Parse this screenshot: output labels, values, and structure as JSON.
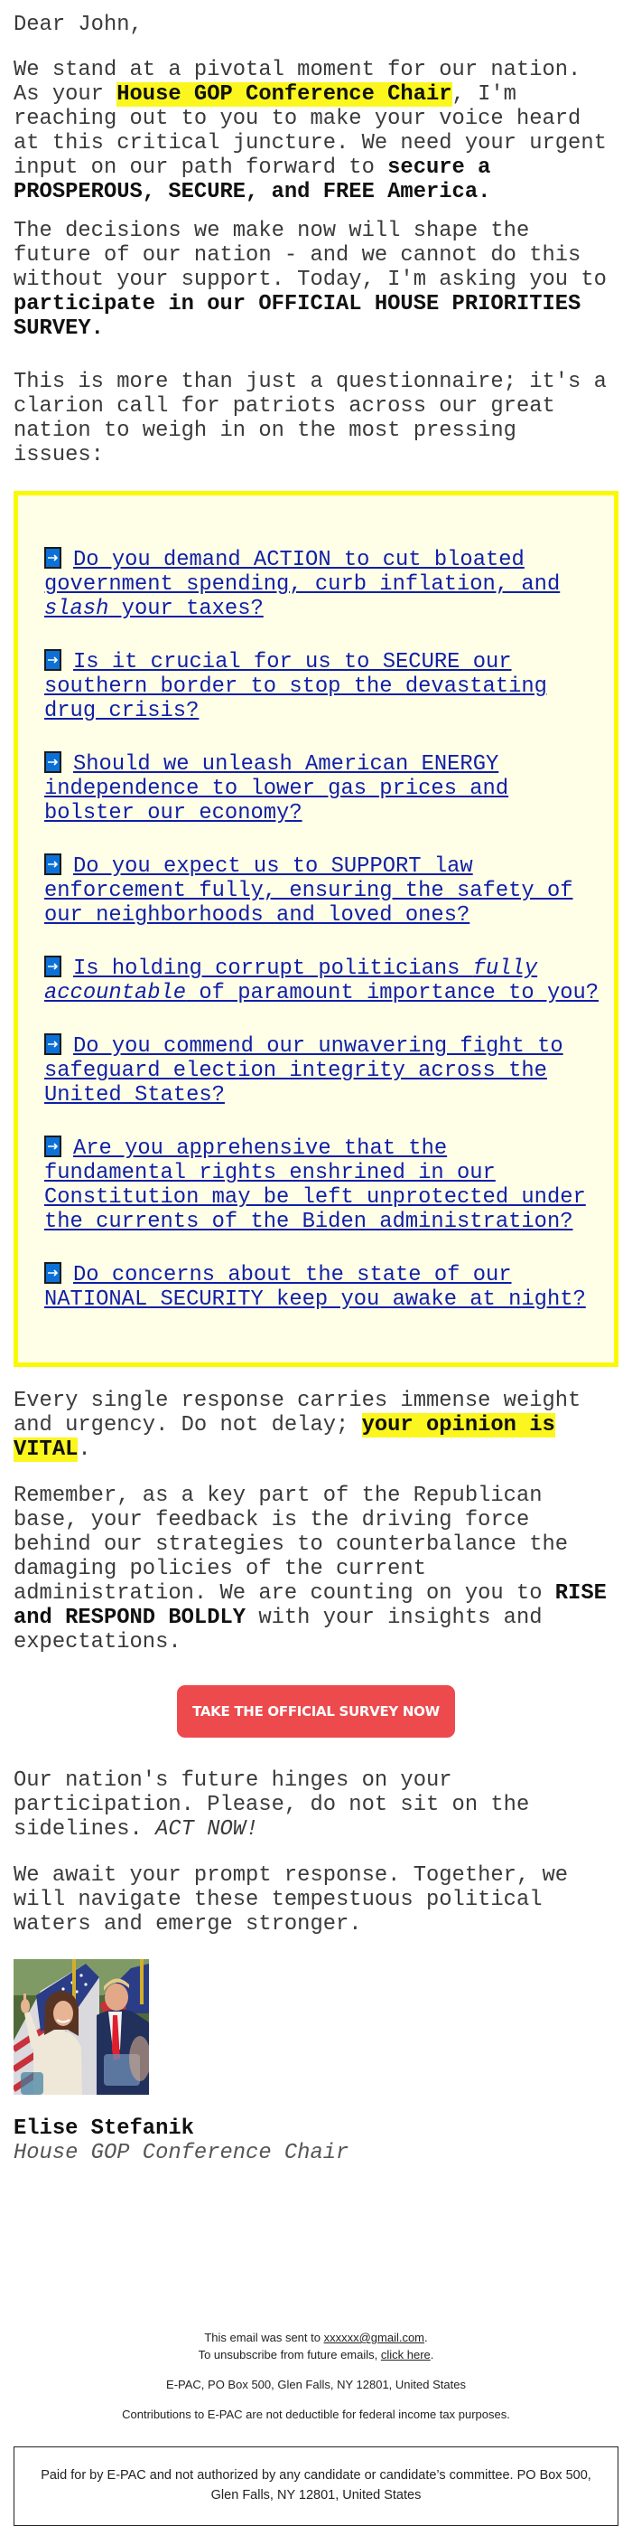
{
  "email": {
    "greeting": "Dear John,",
    "para1": {
      "t1": "We stand at a pivotal moment for our nation. As your ",
      "highlight": "House GOP Conference Chair",
      "t2": ", I'm reaching out to you to make your voice heard at this critical juncture. We need your urgent input on our path forward to ",
      "bold": "secure a PROSPEROUS, SECURE, and FREE America."
    },
    "para2": {
      "t1": "The decisions we make now will shape the future of our nation - and we cannot do this without your support. Today, I'm asking you to ",
      "bold": "participate in our OFFICIAL HOUSE PRIORITIES SURVEY."
    },
    "para3": "This is more than just a questionnaire; it's a clarion call for patriots across our great nation to weigh in on the most pressing issues:",
    "survey": {
      "icon": "right-arrow-button-icon",
      "items": [
        {
          "pre": "Do you demand ACTION to cut bloated government spending, curb inflation, and ",
          "em": "slash",
          "post": " your taxes?"
        },
        {
          "pre": "Is it crucial for us to SECURE our southern border to stop the devastating drug crisis?",
          "em": "",
          "post": ""
        },
        {
          "pre": "Should we unleash American ENERGY independence to lower gas prices and bolster our economy?",
          "em": "",
          "post": ""
        },
        {
          "pre": "Do you expect us to SUPPORT law enforcement fully, ensuring the safety of our neighborhoods and loved ones?",
          "em": "",
          "post": ""
        },
        {
          "pre": "Is holding corrupt politicians ",
          "em": "fully accountable",
          "post": " of paramount importance to you?"
        },
        {
          "pre": "Do you commend our unwavering fight to safeguard election integrity across the United States?",
          "em": "",
          "post": ""
        },
        {
          "pre": "Are you apprehensive that the fundamental rights enshrined in our Constitution may be left unprotected under the currents of the Biden administration?",
          "em": "",
          "post": ""
        },
        {
          "pre": "Do concerns about the state of our NATIONAL SECURITY keep you awake at night?",
          "em": "",
          "post": ""
        }
      ]
    },
    "para4": {
      "t1": "Every single response carries immense weight and urgency. Do not delay; ",
      "highlight": "your opinion is VITAL",
      "t2": "."
    },
    "para5": {
      "t1": "Remember, as a key part of the Republican base, your feedback is the driving force behind our strategies to counterbalance the damaging policies of the current administration. We are counting on you to ",
      "bold": "RISE and RESPOND BOLDLY",
      "t2": " with your insights and expectations."
    },
    "cta_label": "TAKE THE OFFICIAL SURVEY NOW",
    "para6": {
      "t1": "Our nation's future hinges on your participation. Please, do not sit on the sidelines. ",
      "em": "ACT NOW!"
    },
    "para7": "We await your prompt response. Together, we will navigate these tempestuous political waters and emerge stronger.",
    "signature": {
      "photo_alt": "Photo of Elise Stefanik with Donald Trump in front of American flags",
      "name": "Elise Stefanik",
      "title": "House GOP Conference Chair"
    }
  },
  "footer": {
    "sent_to_prefix": "This email was sent to ",
    "sent_to_email": "xxxxxx@gmail.com",
    "sent_to_suffix": ".",
    "unsub_prefix": "To unsubscribe from future emails, ",
    "unsub_link": "click here",
    "unsub_suffix": ".",
    "address": "E-PAC, PO Box 500, Glen Falls, NY 12801, United States",
    "deductible": "Contributions to E-PAC are not deductible for federal income tax purposes.",
    "disclaimer": "Paid for by E-PAC and not authorized by any candidate or candidate’s committee. PO Box 500, Glen Falls, NY 12801, United States"
  },
  "colors": {
    "highlight": "#fbf61e",
    "survey_box_border": "#f9f904",
    "survey_box_bg": "#fffee6",
    "link": "#0f1fa8",
    "arrow_icon_bg": "#0b71d8",
    "cta_bg": "#ec4a4d"
  }
}
